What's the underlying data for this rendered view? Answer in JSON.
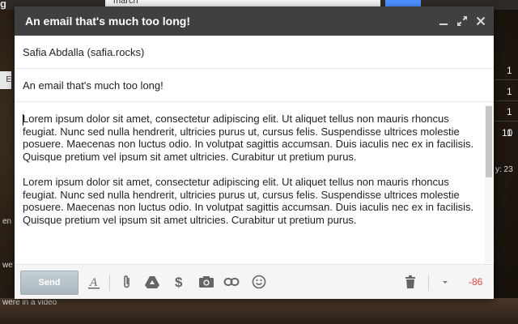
{
  "background": {
    "logo": "g",
    "search_text": "march",
    "left_button": "E",
    "right_counts": [
      "1",
      "1",
      "1",
      "1",
      "10"
    ],
    "side_text": "y: 23",
    "footer_texts": [
      "en",
      "we",
      "were in a video"
    ]
  },
  "compose": {
    "title": "An email that's much too long!",
    "from": "Safia Abdalla (safia.rocks)",
    "subject": "An email that's much too long!",
    "paragraphs": [
      "Lorem ipsum dolor sit amet, consectetur adipiscing elit. Ut aliquet tellus non mauris rhoncus feugiat. Nunc sed nulla hendrerit, ultricies purus ut, cursus felis. Suspendisse ultrices molestie posuere. Maecenas non luctus odio. In volutpat sagittis accumsan. Duis iaculis nec ex in facilisis. Quisque pretium vel ipsum sit amet ultricies. Curabitur ut pretium purus.",
      "Lorem ipsum dolor sit amet, consectetur adipiscing elit. Ut aliquet tellus non mauris rhoncus feugiat. Nunc sed nulla hendrerit, ultricies purus ut, cursus felis. Suspendisse ultrices molestie posuere. Maecenas non luctus odio. In volutpat sagittis accumsan. Duis iaculis nec ex in facilisis. Quisque pretium vel ipsum sit amet ultricies. Curabitur ut pretium purus."
    ],
    "send_label": "Send",
    "char_counter": "-86",
    "icons": {
      "minimize": "minimize-icon",
      "popout": "popout-icon",
      "close": "close-icon",
      "formatting": "text-format-icon",
      "attach": "paperclip-icon",
      "drive": "drive-icon",
      "money": "dollar-icon",
      "photo": "camera-icon",
      "link": "link-icon",
      "emoji": "smiley-icon",
      "discard": "trash-icon",
      "more": "caret-down-icon"
    },
    "colors": {
      "titlebar": "#404040",
      "send_button": "#aab6bd",
      "counter": "#dd4b39"
    }
  }
}
